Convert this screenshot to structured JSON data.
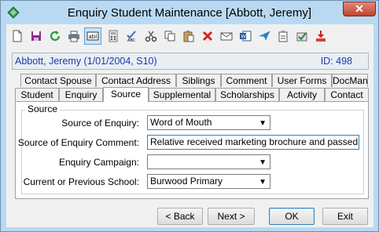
{
  "window": {
    "title": "Enquiry Student Maintenance  [Abbott, Jeremy]",
    "close_glyph": "✕"
  },
  "toolbar": {
    "icons": [
      "new-icon",
      "save-icon",
      "refresh-icon",
      "print-icon",
      "text-field-icon",
      "calculator-icon",
      "spell-check-icon",
      "cut-icon",
      "copy-icon",
      "paste-icon",
      "delete-icon",
      "email-icon",
      "word-icon",
      "send-icon",
      "clipboard-icon",
      "approve-icon",
      "download-icon"
    ]
  },
  "record": {
    "name": "Abbott, Jeremy (1/01/2004, S10)",
    "id": "ID: 498"
  },
  "tabs": {
    "row1": [
      "Contact Spouse",
      "Contact Address",
      "Siblings",
      "Comment",
      "User Forms",
      "DocMan"
    ],
    "row2": [
      "Student",
      "Enquiry",
      "Source",
      "Supplemental",
      "Scholarships",
      "Activity",
      "Contact"
    ],
    "active": "Source"
  },
  "source": {
    "group_title": "Source",
    "source_of_enquiry_label": "Source of Enquiry:",
    "source_of_enquiry_value": "Word of Mouth",
    "comment_label": "Source of Enquiry Comment:",
    "comment_value": "Relative received marketing brochure and passed on",
    "campaign_label": "Enquiry Campaign:",
    "campaign_value": "",
    "school_label": "Current or Previous School:",
    "school_value": "Burwood Primary"
  },
  "buttons": {
    "back": "< Back",
    "next": "Next >",
    "ok": "OK",
    "exit": "Exit"
  },
  "colors": {
    "title_bar": "#b9d9f2",
    "info_text": "#1a3aa8",
    "close": "#c4412c"
  }
}
